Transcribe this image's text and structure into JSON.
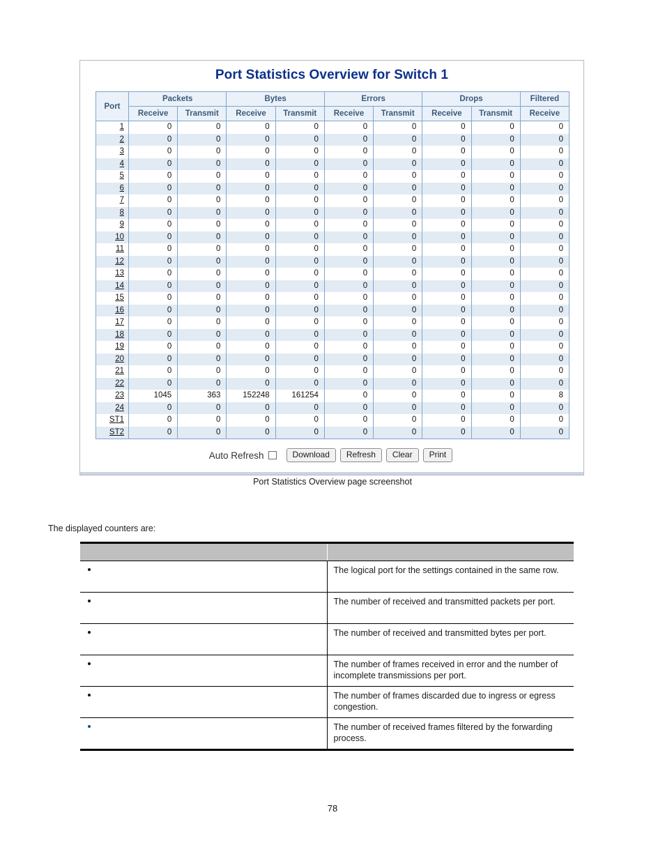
{
  "document": {
    "page_number": "78",
    "intro_text": "The displayed counters are:",
    "figure_caption": "Port Statistics Overview page screenshot"
  },
  "switch_page": {
    "title": "Port Statistics Overview for Switch 1",
    "header": {
      "port_label": "Port",
      "groups": [
        {
          "label": "Packets",
          "subs": [
            "Receive",
            "Transmit"
          ]
        },
        {
          "label": "Bytes",
          "subs": [
            "Receive",
            "Transmit"
          ]
        },
        {
          "label": "Errors",
          "subs": [
            "Receive",
            "Transmit"
          ]
        },
        {
          "label": "Drops",
          "subs": [
            "Receive",
            "Transmit"
          ]
        },
        {
          "label": "Filtered",
          "subs": [
            "Receive"
          ]
        }
      ]
    },
    "rows": [
      {
        "port": "1",
        "values": [
          "0",
          "0",
          "0",
          "0",
          "0",
          "0",
          "0",
          "0",
          "0"
        ]
      },
      {
        "port": "2",
        "values": [
          "0",
          "0",
          "0",
          "0",
          "0",
          "0",
          "0",
          "0",
          "0"
        ]
      },
      {
        "port": "3",
        "values": [
          "0",
          "0",
          "0",
          "0",
          "0",
          "0",
          "0",
          "0",
          "0"
        ]
      },
      {
        "port": "4",
        "values": [
          "0",
          "0",
          "0",
          "0",
          "0",
          "0",
          "0",
          "0",
          "0"
        ]
      },
      {
        "port": "5",
        "values": [
          "0",
          "0",
          "0",
          "0",
          "0",
          "0",
          "0",
          "0",
          "0"
        ]
      },
      {
        "port": "6",
        "values": [
          "0",
          "0",
          "0",
          "0",
          "0",
          "0",
          "0",
          "0",
          "0"
        ]
      },
      {
        "port": "7",
        "values": [
          "0",
          "0",
          "0",
          "0",
          "0",
          "0",
          "0",
          "0",
          "0"
        ]
      },
      {
        "port": "8",
        "values": [
          "0",
          "0",
          "0",
          "0",
          "0",
          "0",
          "0",
          "0",
          "0"
        ]
      },
      {
        "port": "9",
        "values": [
          "0",
          "0",
          "0",
          "0",
          "0",
          "0",
          "0",
          "0",
          "0"
        ]
      },
      {
        "port": "10",
        "values": [
          "0",
          "0",
          "0",
          "0",
          "0",
          "0",
          "0",
          "0",
          "0"
        ]
      },
      {
        "port": "11",
        "values": [
          "0",
          "0",
          "0",
          "0",
          "0",
          "0",
          "0",
          "0",
          "0"
        ]
      },
      {
        "port": "12",
        "values": [
          "0",
          "0",
          "0",
          "0",
          "0",
          "0",
          "0",
          "0",
          "0"
        ]
      },
      {
        "port": "13",
        "values": [
          "0",
          "0",
          "0",
          "0",
          "0",
          "0",
          "0",
          "0",
          "0"
        ]
      },
      {
        "port": "14",
        "values": [
          "0",
          "0",
          "0",
          "0",
          "0",
          "0",
          "0",
          "0",
          "0"
        ]
      },
      {
        "port": "15",
        "values": [
          "0",
          "0",
          "0",
          "0",
          "0",
          "0",
          "0",
          "0",
          "0"
        ]
      },
      {
        "port": "16",
        "values": [
          "0",
          "0",
          "0",
          "0",
          "0",
          "0",
          "0",
          "0",
          "0"
        ]
      },
      {
        "port": "17",
        "values": [
          "0",
          "0",
          "0",
          "0",
          "0",
          "0",
          "0",
          "0",
          "0"
        ]
      },
      {
        "port": "18",
        "values": [
          "0",
          "0",
          "0",
          "0",
          "0",
          "0",
          "0",
          "0",
          "0"
        ]
      },
      {
        "port": "19",
        "values": [
          "0",
          "0",
          "0",
          "0",
          "0",
          "0",
          "0",
          "0",
          "0"
        ]
      },
      {
        "port": "20",
        "values": [
          "0",
          "0",
          "0",
          "0",
          "0",
          "0",
          "0",
          "0",
          "0"
        ]
      },
      {
        "port": "21",
        "values": [
          "0",
          "0",
          "0",
          "0",
          "0",
          "0",
          "0",
          "0",
          "0"
        ]
      },
      {
        "port": "22",
        "values": [
          "0",
          "0",
          "0",
          "0",
          "0",
          "0",
          "0",
          "0",
          "0"
        ]
      },
      {
        "port": "23",
        "values": [
          "1045",
          "363",
          "152248",
          "161254",
          "0",
          "0",
          "0",
          "0",
          "8"
        ]
      },
      {
        "port": "24",
        "values": [
          "0",
          "0",
          "0",
          "0",
          "0",
          "0",
          "0",
          "0",
          "0"
        ]
      },
      {
        "port": "ST1",
        "values": [
          "0",
          "0",
          "0",
          "0",
          "0",
          "0",
          "0",
          "0",
          "0"
        ]
      },
      {
        "port": "ST2",
        "values": [
          "0",
          "0",
          "0",
          "0",
          "0",
          "0",
          "0",
          "0",
          "0"
        ]
      }
    ],
    "controls": {
      "auto_refresh_label": "Auto Refresh",
      "auto_refresh_checked": false,
      "buttons": [
        "Download",
        "Refresh",
        "Clear",
        "Print"
      ]
    },
    "colors": {
      "title": "#0b2f8a",
      "header_bg": "#eaf1f9",
      "header_text": "#3c5a79",
      "grid": "#7fa5cc",
      "row_alt_bg": "#e2ebf4"
    }
  },
  "counters_table": {
    "header": {
      "object_label": "",
      "description_label": ""
    },
    "rows": [
      {
        "object": "",
        "description": "The logical port for the settings contained in the same row."
      },
      {
        "object": "",
        "description": "The number of received and transmitted packets per port."
      },
      {
        "object": "",
        "description": "The number of received and transmitted bytes per port."
      },
      {
        "object": "",
        "description": "The number of frames received in error and the number of incomplete transmissions per port."
      },
      {
        "object": "",
        "description": "The number of frames discarded due to ingress or egress congestion."
      },
      {
        "object": "",
        "description": "The number of received frames filtered by the forwarding process."
      }
    ]
  }
}
